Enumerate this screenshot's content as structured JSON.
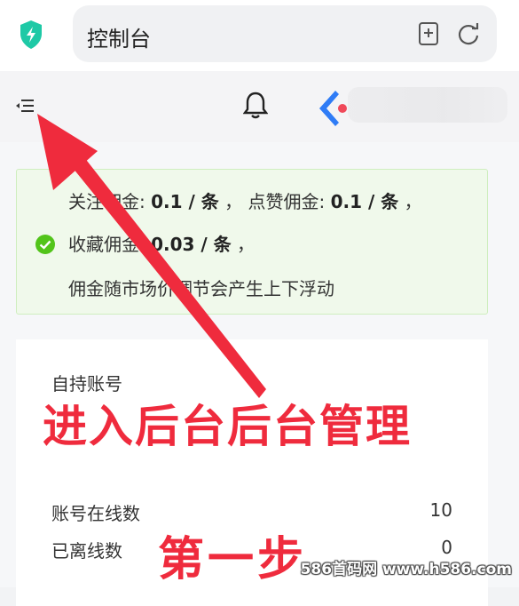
{
  "browser": {
    "address_text": "控制台"
  },
  "notice": {
    "line1_label_a": "关注佣金:",
    "line1_value_a": "0.1 / 条",
    "line1_sep": "，",
    "line1_label_b": "点赞佣金:",
    "line1_value_b": "0.1 / 条",
    "line1_end": "，",
    "line2_label": "收藏佣金:",
    "line2_value": "0.03 / 条",
    "line2_end": "，",
    "line3": "佣金随市场价调节会产生上下浮动"
  },
  "account_card": {
    "title": "自持账号",
    "rows": [
      {
        "label": "账号在线数",
        "value": "10"
      },
      {
        "label": "已离线数",
        "value": "0"
      }
    ]
  },
  "annotation": {
    "title": "进入后台后台管理",
    "step": "第一步",
    "color": "#ef2b3d"
  },
  "watermark": "586首码网 www.h586.com",
  "colors": {
    "notice_bg": "#f0f9eb",
    "notice_border": "#cfeebf",
    "success": "#52c41a",
    "shield": "#1ec9a6",
    "logo_blue": "#2f7cf6",
    "logo_red": "#f0495a"
  }
}
